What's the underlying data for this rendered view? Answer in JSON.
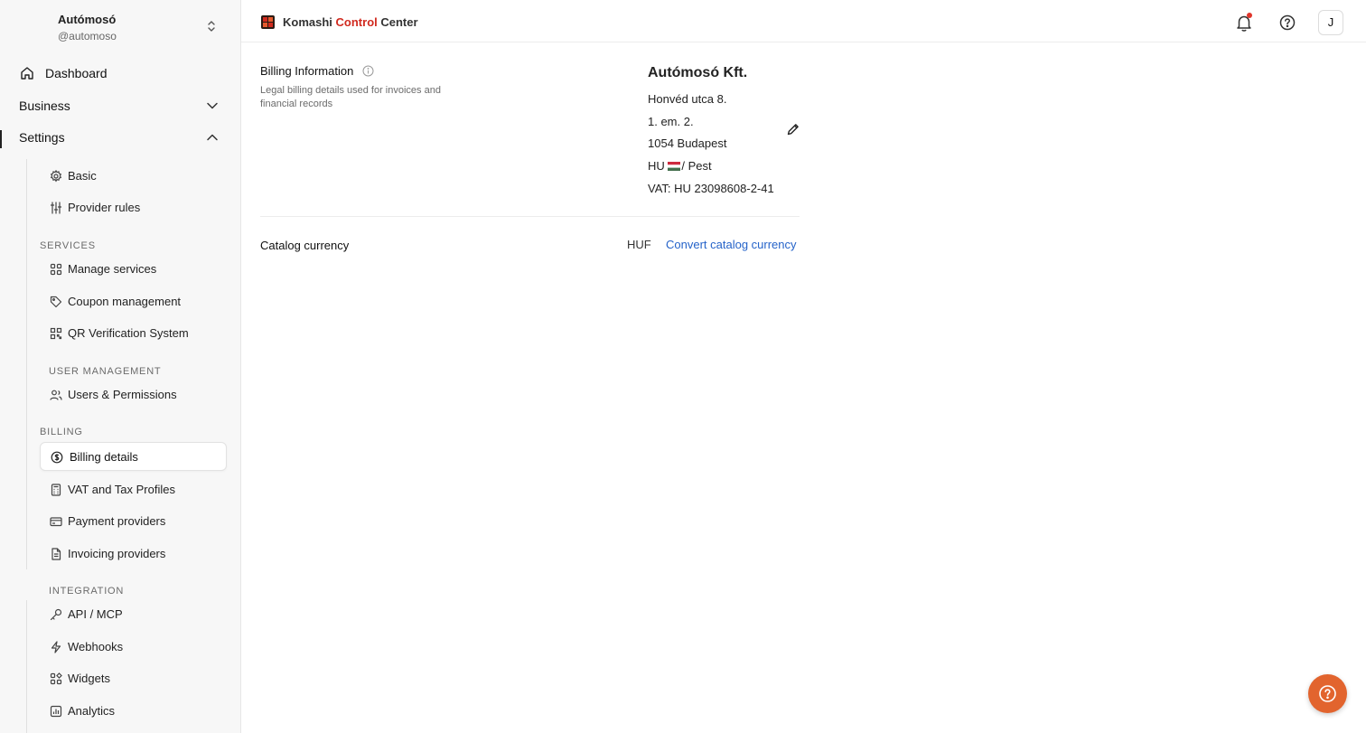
{
  "workspace": {
    "name": "Autómosó",
    "handle": "@automoso"
  },
  "nav": {
    "dashboard": "Dashboard",
    "business": "Business",
    "settings": "Settings"
  },
  "settings_menu": {
    "basic": "Basic",
    "provider_rules": "Provider rules",
    "services_section": "SERVICES",
    "manage_services": "Manage services",
    "coupon_management": "Coupon management",
    "qr_verification": "QR Verification System",
    "user_mgmt_section": "USER MANAGEMENT",
    "users_permissions": "Users & Permissions",
    "billing_section": "BILLING",
    "billing_details": "Billing details",
    "vat_tax": "VAT and Tax Profiles",
    "payment_providers": "Payment providers",
    "invoicing_providers": "Invoicing providers",
    "integration_section": "INTEGRATION",
    "api_mcp": "API / MCP",
    "webhooks": "Webhooks",
    "widgets": "Widgets",
    "analytics": "Analytics"
  },
  "header": {
    "brand_part1": "Komashi",
    "brand_part2": "Control",
    "brand_part3": "Center",
    "avatar_initial": "J"
  },
  "billing": {
    "title": "Billing Information",
    "description": "Legal billing details used for invoices and financial records",
    "company_name": "Autómosó Kft.",
    "street": "Honvéd utca 8.",
    "floor": "1. em. 2.",
    "city": "1054 Budapest",
    "country_code": "HU",
    "region": "/ Pest",
    "vat": "VAT: HU 23098608-2-41"
  },
  "catalog": {
    "label": "Catalog currency",
    "currency": "HUF",
    "convert_link": "Convert catalog currency"
  },
  "colors": {
    "brand_red": "#d12a1f",
    "link_blue": "#2563c9",
    "help_fab": "#e2642e",
    "notification_dot": "#e0352b"
  }
}
